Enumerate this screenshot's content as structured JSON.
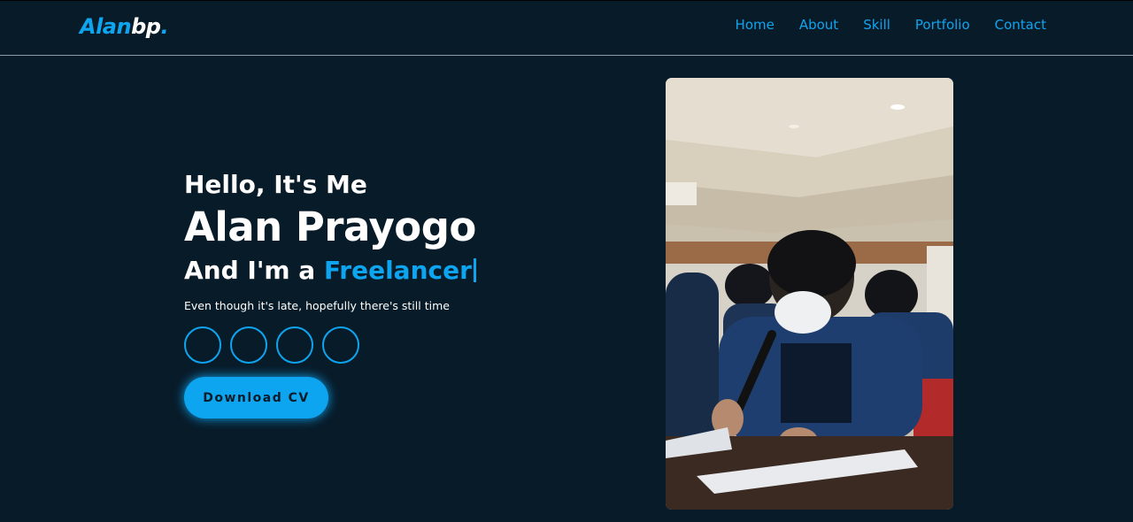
{
  "header": {
    "logo": {
      "accent": "Alan",
      "rest": "bp",
      "dot": "."
    },
    "nav": [
      "Home",
      "About",
      "Skill",
      "Portfolio",
      "Contact"
    ]
  },
  "hero": {
    "greeting": "Hello, It's Me",
    "name": "Alan Prayogo",
    "role_prefix": "And I'm a ",
    "role": "Freelancer",
    "tagline": "Even though it's late, hopefully there's still time",
    "socials": [
      "social-icon-1",
      "social-icon-2",
      "social-icon-3",
      "social-icon-4"
    ],
    "cv_button": "Download CV"
  },
  "colors": {
    "background": "#081b29",
    "accent": "#0ea5f0",
    "text": "#ffffff"
  }
}
